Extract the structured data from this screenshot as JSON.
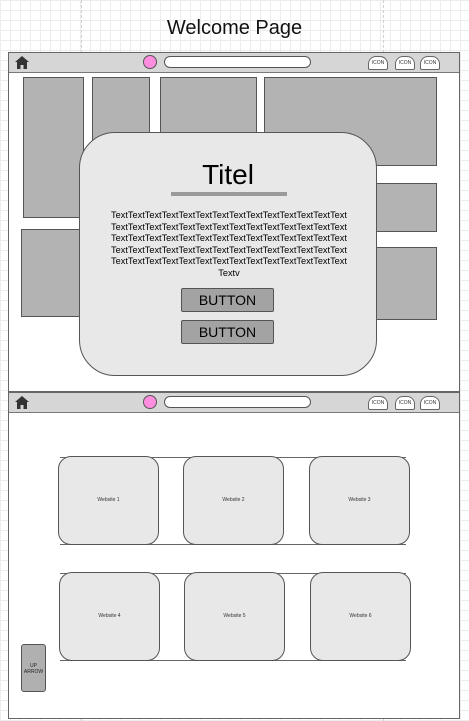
{
  "page": {
    "title": "Welcome Page"
  },
  "browser_top": {
    "icons": [
      "ICON",
      "ICON",
      "ICON"
    ]
  },
  "modal": {
    "title": "Titel",
    "body": "TextTextTextTextTextTextTextTextTextTextTextTextTextTextTextTextTextTextTextTextTextTextTextTextTextTextTextTextTextTextTextTextTextTextTextTextTextTextTextTextTextTextTextTextTextTextTextTextTextTextTextTextTextTextTextTextTextTextTextTextTextTextTextTextTextTextTextTextTextTextTextv",
    "button1_label": "BUTTON",
    "button2_label": "BUTTON"
  },
  "browser_bottom": {
    "icons": [
      "ICON",
      "ICON",
      "ICON"
    ]
  },
  "websites": [
    "Website 1",
    "Website 2",
    "Website 3",
    "Website 4",
    "Website 5",
    "Website 6"
  ],
  "up_arrow": {
    "line1": "UP",
    "line2": "ARROW"
  }
}
